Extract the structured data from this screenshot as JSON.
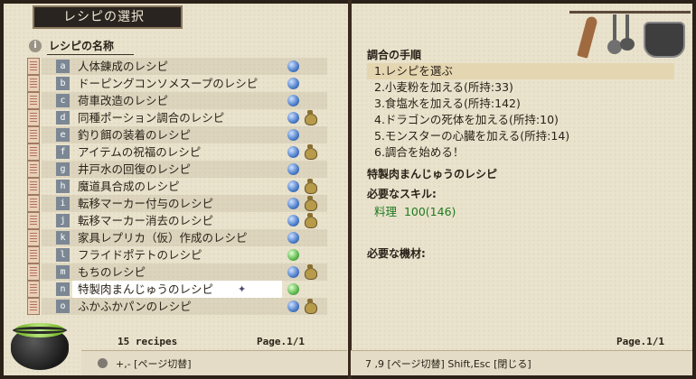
{
  "window": {
    "title": "レシピの選択"
  },
  "list": {
    "header": "レシピの名称",
    "items": [
      {
        "key": "a",
        "label": "人体錬成のレシピ",
        "orb": "blue",
        "bag": false,
        "selected": false
      },
      {
        "key": "b",
        "label": "ドーピングコンソメスープのレシピ",
        "orb": "blue",
        "bag": false,
        "selected": false
      },
      {
        "key": "c",
        "label": "荷車改造のレシピ",
        "orb": "blue",
        "bag": false,
        "selected": false
      },
      {
        "key": "d",
        "label": "同種ポーション調合のレシピ",
        "orb": "blue",
        "bag": true,
        "selected": false
      },
      {
        "key": "e",
        "label": "釣り餌の装着のレシピ",
        "orb": "blue",
        "bag": false,
        "selected": false
      },
      {
        "key": "f",
        "label": "アイテムの祝福のレシピ",
        "orb": "blue",
        "bag": true,
        "selected": false
      },
      {
        "key": "g",
        "label": "井戸水の回復のレシピ",
        "orb": "blue",
        "bag": false,
        "selected": false
      },
      {
        "key": "h",
        "label": "魔道具合成のレシピ",
        "orb": "blue",
        "bag": true,
        "selected": false
      },
      {
        "key": "i",
        "label": "転移マーカー付与のレシピ",
        "orb": "blue",
        "bag": true,
        "selected": false
      },
      {
        "key": "j",
        "label": "転移マーカー消去のレシピ",
        "orb": "blue",
        "bag": true,
        "selected": false
      },
      {
        "key": "k",
        "label": "家具レプリカ（仮）作成のレシピ",
        "orb": "blue",
        "bag": false,
        "selected": false
      },
      {
        "key": "l",
        "label": "フライドポテトのレシピ",
        "orb": "green",
        "bag": false,
        "selected": false
      },
      {
        "key": "m",
        "label": "もちのレシピ",
        "orb": "blue",
        "bag": true,
        "selected": false
      },
      {
        "key": "n",
        "label": "特製肉まんじゅうのレシピ",
        "orb": "green",
        "bag": false,
        "selected": true
      },
      {
        "key": "o",
        "label": "ふかふかパンのレシピ",
        "orb": "blue",
        "bag": true,
        "selected": false
      }
    ],
    "count_text": "15 recipes",
    "page_text": "Page.1/1",
    "hint_text": "+,- [ページ切替]"
  },
  "detail": {
    "procedure_header": "調合の手順",
    "steps": [
      "1.レシピを選ぶ",
      "2.小麦粉を加える(所持:33)",
      "3.食塩水を加える(所持:142)",
      "4.ドラゴンの死体を加える(所持:10)",
      "5.モンスターの心臓を加える(所持:14)",
      "6.調合を始める！"
    ],
    "recipe_title": "特製肉まんじゅうのレシピ",
    "skills_header": "必要なスキル:",
    "skill_line": "料理  100(146)",
    "materials_header": "必要な機材:",
    "page_text": "Page.1/1",
    "hint_text": "7 ,9 [ページ切替]  Shift,Esc [閉じる]"
  },
  "colors": {
    "parchment": "#e9e2cc",
    "skill_green": "#1e7a1e",
    "step_highlight": "#e4d6b0",
    "key_badge": "#7c8794"
  }
}
